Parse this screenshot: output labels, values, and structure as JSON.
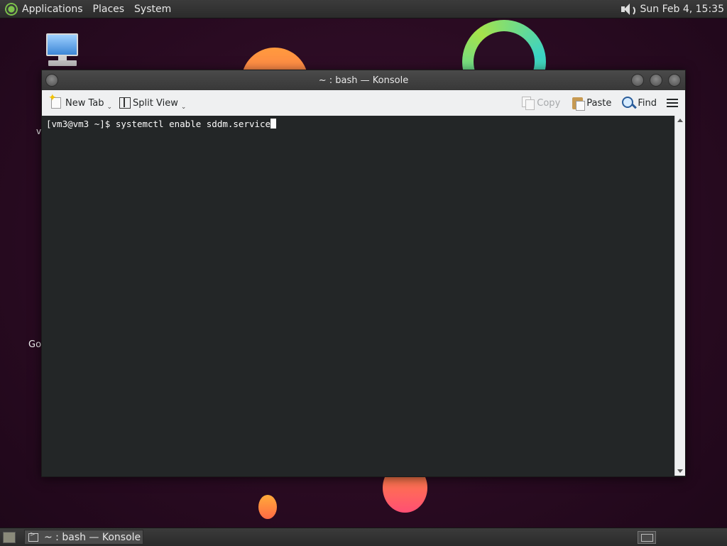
{
  "top_panel": {
    "menus": [
      "Applications",
      "Places",
      "System"
    ],
    "clock": "Sun Feb  4, 15:35",
    "icons": [
      "distro-logo-icon",
      "volume-icon"
    ]
  },
  "desktop": {
    "icons": [
      {
        "name": "computer-icon",
        "label": "v"
      },
      {
        "label": "Go"
      }
    ]
  },
  "window": {
    "title": "~ : bash — Konsole",
    "toolbar": {
      "new_tab": "New Tab",
      "split_view": "Split View",
      "copy": "Copy",
      "paste": "Paste",
      "find": "Find"
    },
    "terminal": {
      "prompt": "[vm3@vm3 ~]$ ",
      "command": "systemctl enable sddm.service"
    }
  },
  "bottom_panel": {
    "task_label": "~ : bash — Konsole"
  }
}
